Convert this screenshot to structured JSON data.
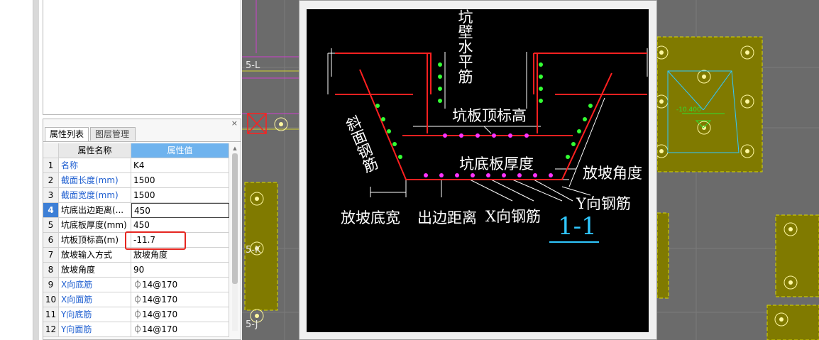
{
  "panel": {
    "close_label": "×",
    "tabs": [
      {
        "label": "属性列表"
      },
      {
        "label": "图层管理"
      }
    ],
    "columns": {
      "name": "属性名称",
      "value": "属性值"
    },
    "rows": [
      {
        "num": "1",
        "name": "名称",
        "value": "K4"
      },
      {
        "num": "2",
        "name": "截面长度(mm)",
        "value": "1500"
      },
      {
        "num": "3",
        "name": "截面宽度(mm)",
        "value": "1500"
      },
      {
        "num": "4",
        "name": "坑底出边距离(...",
        "value": "450"
      },
      {
        "num": "5",
        "name": "坑底板厚度(mm)",
        "value": "450"
      },
      {
        "num": "6",
        "name": "坑板顶标高(m)",
        "value": "-11.7"
      },
      {
        "num": "7",
        "name": "放坡输入方式",
        "value": "放坡角度"
      },
      {
        "num": "8",
        "name": "放坡角度",
        "value": "90"
      },
      {
        "num": "9",
        "name": "X向底筋",
        "value": "⏀14@170"
      },
      {
        "num": "10",
        "name": "X向面筋",
        "value": "⏀14@170"
      },
      {
        "num": "11",
        "name": "Y向底筋",
        "value": "⏀14@170"
      },
      {
        "num": "12",
        "name": "Y向面筋",
        "value": "⏀14@170"
      }
    ],
    "colors": {
      "header_value_bg": "#6fb3ee",
      "blue_text": "#1f5fd0",
      "highlight_box": "#e52620",
      "selected_row": "#3d7fd6"
    }
  },
  "cad": {
    "labels": [
      "5-L",
      "5-K",
      "5-J"
    ],
    "elevation": "-10.400"
  },
  "drawing": {
    "labels": {
      "wall_horizontal_rebar": "坑壁水平筋",
      "slope_rebar": "斜面钢筋",
      "slab_top_elevation": "坑板顶标高",
      "slab_thickness": "坑底板厚度",
      "slope_angle": "放坡角度",
      "y_rebar": "Y向钢筋",
      "slope_base_width": "放坡底宽",
      "edge_distance": "出边距离",
      "x_rebar": "X向钢筋",
      "section": "1-1"
    },
    "colors": {
      "rebar_dot_green": "#33ff33",
      "rebar_dot_magenta": "#ff33ff",
      "concrete_line": "#ff2020",
      "section_mark": "#30c8ff"
    }
  }
}
